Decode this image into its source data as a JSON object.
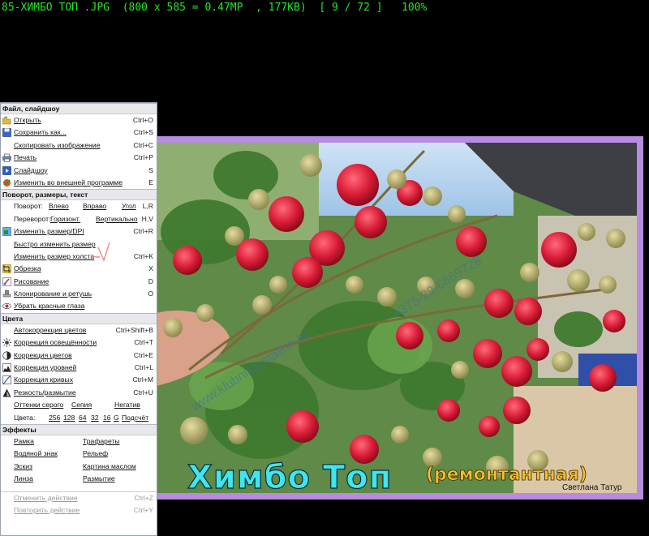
{
  "titlebar": "85-ХИМБО ТОП .JPG  (800 x 585 = 0.47MP  , 177KB)  [ 9 / 72 ]   100%",
  "photo": {
    "caption_main": "Химбо Топ",
    "caption_sub": "(ремонтантная)",
    "author": "Светлана Татур",
    "watermark_1": "www.klubnika-malina.by",
    "watermark_2": "+375-29-6669728"
  },
  "menu": {
    "file": {
      "header": "Файл, слайдшоу",
      "items": [
        {
          "label": "Открыть",
          "shortcut": "Ctrl+O"
        },
        {
          "label": "Сохранить как...",
          "shortcut": "Ctrl+S"
        },
        {
          "label": "Скопировать изображение",
          "shortcut": "Ctrl+C"
        },
        {
          "label": "Печать",
          "shortcut": "Ctrl+P"
        },
        {
          "label": "Слайдшоу",
          "shortcut": "S"
        },
        {
          "label": "Изменить во внешней программе",
          "shortcut": "E"
        }
      ]
    },
    "transform": {
      "header": "Поворот, размеры, текст",
      "rotate_label": "Поворот:",
      "rotate_left": "Влево",
      "rotate_right": "Вправо",
      "rotate_angle": "Угол",
      "rotate_shortcut": "L,R",
      "flip_label": "Переворот:",
      "flip_h": "Горизонт.",
      "flip_v": "Вертикально",
      "flip_shortcut": "H,V",
      "items": [
        {
          "label": "Изменить размер/DPI",
          "shortcut": "Ctrl+R"
        },
        {
          "label": "Быстро изменить размер",
          "shortcut": ""
        },
        {
          "label": "Изменить размер холста",
          "shortcut": "Ctrl+K"
        },
        {
          "label": "Обрезка",
          "shortcut": "X"
        },
        {
          "label": "Рисование",
          "shortcut": "D"
        },
        {
          "label": "Клонирование и ретушь",
          "shortcut": "O"
        },
        {
          "label": "Убрать красные глаза",
          "shortcut": ""
        }
      ]
    },
    "colors": {
      "header": "Цвета",
      "items": [
        {
          "label": "Автокоррекция цветов",
          "shortcut": "Ctrl+Shift+B"
        },
        {
          "label": "Коррекция освещённости",
          "shortcut": "Ctrl+T"
        },
        {
          "label": "Коррекция цветов",
          "shortcut": "Ctrl+E"
        },
        {
          "label": "Коррекция уровней",
          "shortcut": "Ctrl+L"
        },
        {
          "label": "Коррекция кривых",
          "shortcut": "Ctrl+M"
        },
        {
          "label": "Резкость/размытие",
          "shortcut": "Ctrl+U"
        }
      ],
      "gray": "Оттенки серого",
      "sepia": "Сепия",
      "negative": "Негатив",
      "count_label": "Цвета:",
      "counts": [
        "256",
        "128",
        "64",
        "32",
        "16",
        "G"
      ],
      "count_tally": "Подсчёт"
    },
    "effects": {
      "header": "Эффекты",
      "frame": "Рамка",
      "stencils": "Трафареты",
      "watermark": "Водяной знак",
      "relief": "Рельеф",
      "sketch": "Эскиз",
      "oil": "Картина маслом",
      "lens": "Линза",
      "blur": "Размытие"
    },
    "undo": {
      "label": "Отменить действие",
      "shortcut": "Ctrl+Z"
    },
    "redo": {
      "label": "Повторить действие",
      "shortcut": "Ctrl+Y"
    }
  }
}
